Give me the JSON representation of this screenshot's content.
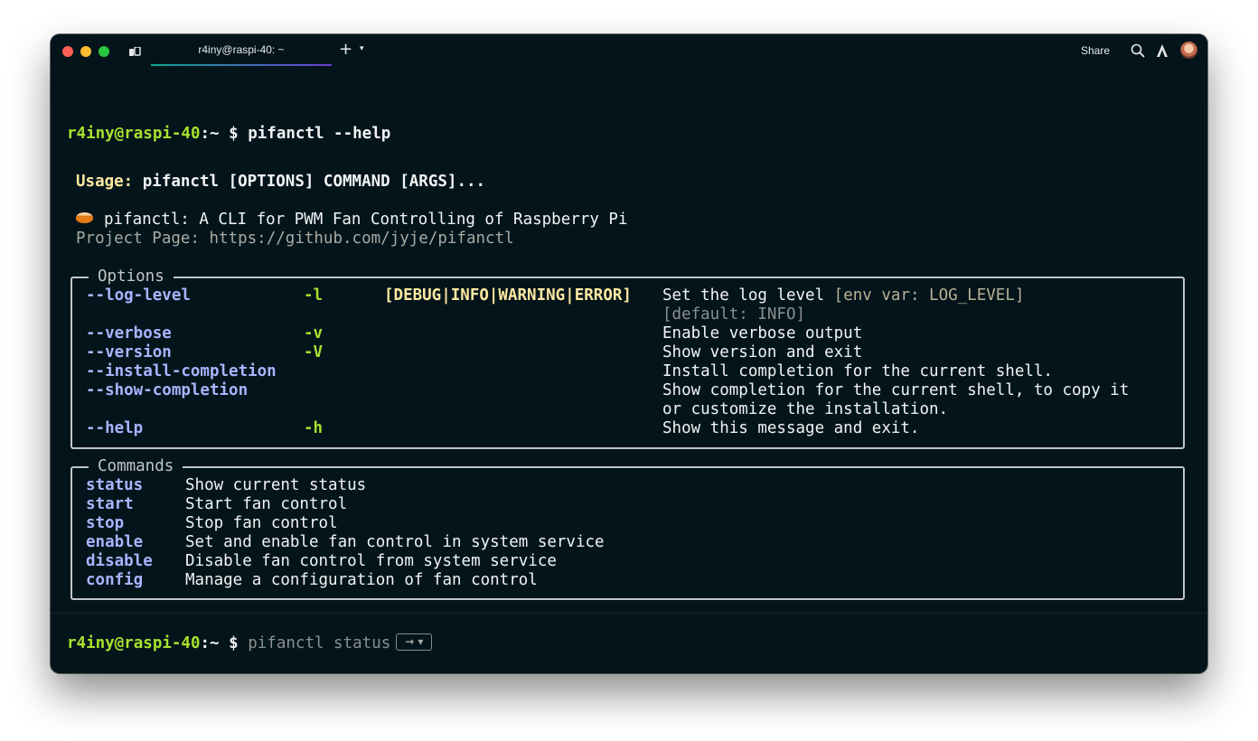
{
  "window": {
    "tab_title": "r4iny@raspi-40: ~",
    "share_label": "Share",
    "icons": [
      "sidebar-icon",
      "plus-icon",
      "chevron-down-icon",
      "search-icon",
      "ai-assistant-icon",
      "avatar"
    ]
  },
  "prompt": {
    "user_host": "r4iny@raspi-40",
    "path": ":~",
    "symbol": "$"
  },
  "command_entered": "pifanctl --help",
  "usage": {
    "label": "Usage:",
    "text": " pifanctl [OPTIONS] COMMAND [ARGS]..."
  },
  "description": {
    "emoji": "fan-emoji",
    "title": "pifanctl: A CLI for PWM Fan Controlling of Raspberry Pi",
    "project_page": "Project Page: https://github.com/jyje/pifanctl"
  },
  "options_panel": {
    "title": "Options",
    "rows": [
      {
        "name": "--log-level",
        "short": "-l",
        "type": "[DEBUG|INFO|WARNING|ERROR]",
        "desc": "Set the log level",
        "env": "[env var: LOG_LEVEL]",
        "extra": "[default: INFO]"
      },
      {
        "name": "--verbose",
        "short": "-v",
        "type": "",
        "desc": "Enable verbose output"
      },
      {
        "name": "--version",
        "short": "-V",
        "type": "",
        "desc": "Show version and exit"
      },
      {
        "name": "--install-completion",
        "short": "",
        "type": "",
        "desc": "Install completion for the current shell."
      },
      {
        "name": "--show-completion",
        "short": "",
        "type": "",
        "desc": "Show completion for the current shell, to copy it",
        "desc2": "or customize the installation."
      },
      {
        "name": "--help",
        "short": "-h",
        "type": "",
        "desc": "Show this message and exit."
      }
    ]
  },
  "commands_panel": {
    "title": "Commands",
    "rows": [
      {
        "name": "status",
        "desc": "Show current status"
      },
      {
        "name": "start",
        "desc": "Start fan control"
      },
      {
        "name": "stop",
        "desc": "Stop fan control"
      },
      {
        "name": "enable",
        "desc": "Set and enable fan control in system service"
      },
      {
        "name": "disable",
        "desc": "Disable fan control from system service"
      },
      {
        "name": "config",
        "desc": "Manage a configuration of fan control"
      }
    ]
  },
  "input": {
    "suggestion": "pifanctl status",
    "accept_key": "→ ▾"
  },
  "colors": {
    "background": "#03141b",
    "prompt_green": "#a6e22e",
    "option_blue": "#a8b5ff",
    "type_yellow": "#ffe9a0"
  }
}
